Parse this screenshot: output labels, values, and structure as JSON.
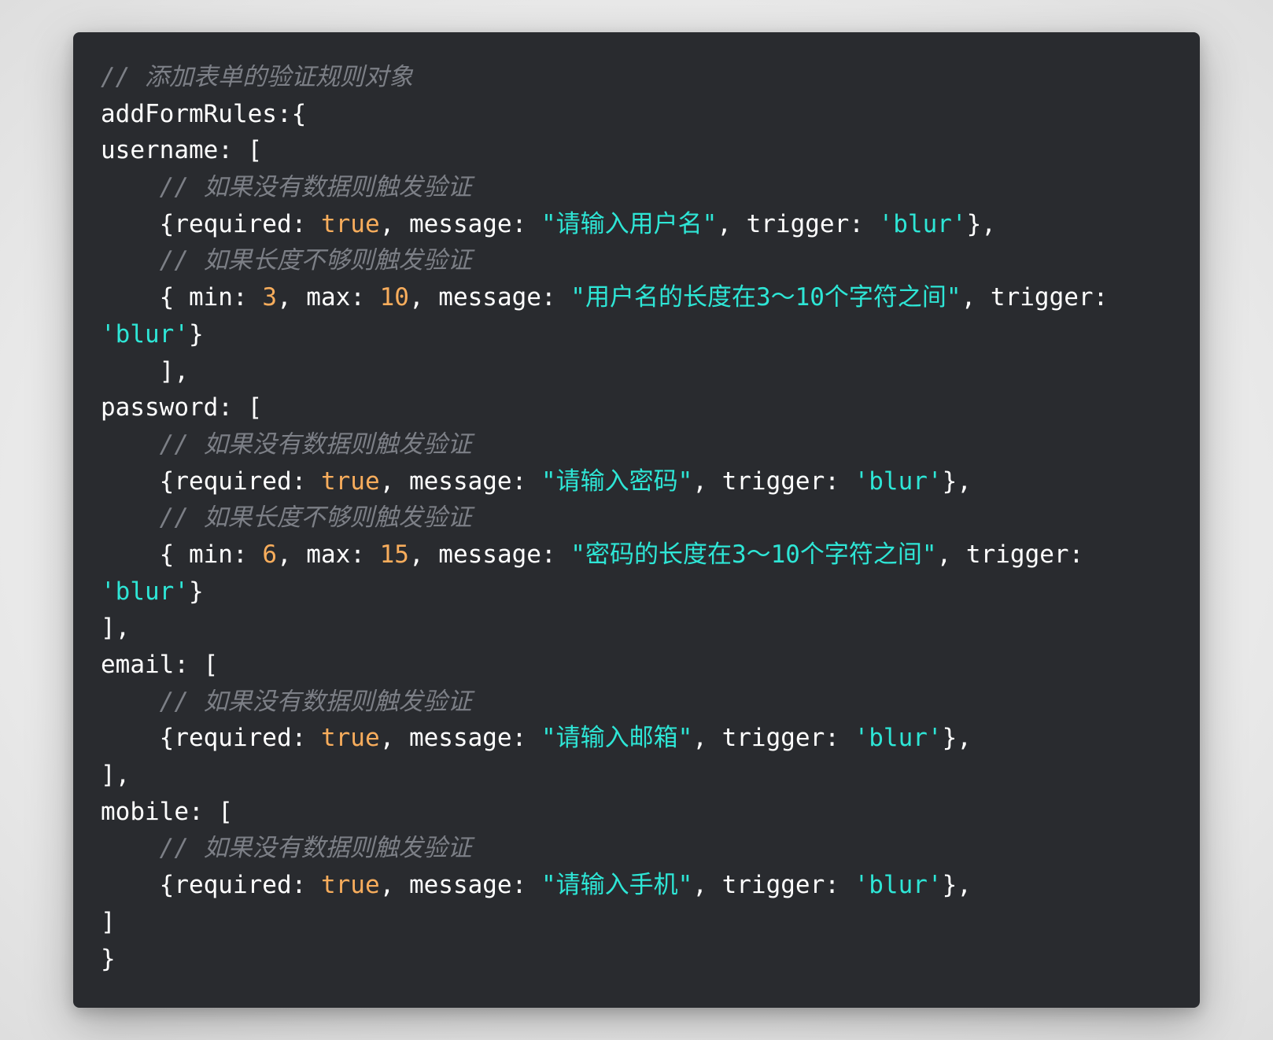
{
  "code": {
    "language": "javascript",
    "lines": [
      [
        {
          "t": "cmt",
          "s": "// 添加表单的验证规则对象"
        }
      ],
      [
        {
          "t": "pln",
          "s": "addFormRules:{"
        }
      ],
      [
        {
          "t": "pln",
          "s": "username: ["
        }
      ],
      [
        {
          "t": "cmt",
          "s": "    // 如果没有数据则触发验证"
        }
      ],
      [
        {
          "t": "pln",
          "s": "    {required: "
        },
        {
          "t": "kw",
          "s": "true"
        },
        {
          "t": "pln",
          "s": ", message: "
        },
        {
          "t": "str",
          "s": "\"请输入用户名\""
        },
        {
          "t": "pln",
          "s": ", trigger: "
        },
        {
          "t": "str",
          "s": "'blur'"
        },
        {
          "t": "pln",
          "s": "},"
        }
      ],
      [
        {
          "t": "cmt",
          "s": "    // 如果长度不够则触发验证"
        }
      ],
      [
        {
          "t": "pln",
          "s": "    { min: "
        },
        {
          "t": "num",
          "s": "3"
        },
        {
          "t": "pln",
          "s": ", max: "
        },
        {
          "t": "num",
          "s": "10"
        },
        {
          "t": "pln",
          "s": ", message: "
        },
        {
          "t": "str",
          "s": "\"用户名的长度在3～10个字符之间\""
        },
        {
          "t": "pln",
          "s": ", trigger:"
        }
      ],
      [
        {
          "t": "str",
          "s": "'blur'"
        },
        {
          "t": "pln",
          "s": "}"
        }
      ],
      [
        {
          "t": "pln",
          "s": "    ],"
        }
      ],
      [
        {
          "t": "pln",
          "s": "password: ["
        }
      ],
      [
        {
          "t": "cmt",
          "s": "    // 如果没有数据则触发验证"
        }
      ],
      [
        {
          "t": "pln",
          "s": "    {required: "
        },
        {
          "t": "kw",
          "s": "true"
        },
        {
          "t": "pln",
          "s": ", message: "
        },
        {
          "t": "str",
          "s": "\"请输入密码\""
        },
        {
          "t": "pln",
          "s": ", trigger: "
        },
        {
          "t": "str",
          "s": "'blur'"
        },
        {
          "t": "pln",
          "s": "},"
        }
      ],
      [
        {
          "t": "cmt",
          "s": "    // 如果长度不够则触发验证"
        }
      ],
      [
        {
          "t": "pln",
          "s": "    { min: "
        },
        {
          "t": "num",
          "s": "6"
        },
        {
          "t": "pln",
          "s": ", max: "
        },
        {
          "t": "num",
          "s": "15"
        },
        {
          "t": "pln",
          "s": ", message: "
        },
        {
          "t": "str",
          "s": "\"密码的长度在3～10个字符之间\""
        },
        {
          "t": "pln",
          "s": ", trigger:"
        }
      ],
      [
        {
          "t": "str",
          "s": "'blur'"
        },
        {
          "t": "pln",
          "s": "}"
        }
      ],
      [
        {
          "t": "pln",
          "s": "],"
        }
      ],
      [
        {
          "t": "pln",
          "s": "email: ["
        }
      ],
      [
        {
          "t": "cmt",
          "s": "    // 如果没有数据则触发验证"
        }
      ],
      [
        {
          "t": "pln",
          "s": "    {required: "
        },
        {
          "t": "kw",
          "s": "true"
        },
        {
          "t": "pln",
          "s": ", message: "
        },
        {
          "t": "str",
          "s": "\"请输入邮箱\""
        },
        {
          "t": "pln",
          "s": ", trigger: "
        },
        {
          "t": "str",
          "s": "'blur'"
        },
        {
          "t": "pln",
          "s": "},"
        }
      ],
      [
        {
          "t": "pln",
          "s": "],"
        }
      ],
      [
        {
          "t": "pln",
          "s": "mobile: ["
        }
      ],
      [
        {
          "t": "cmt",
          "s": "    // 如果没有数据则触发验证"
        }
      ],
      [
        {
          "t": "pln",
          "s": "    {required: "
        },
        {
          "t": "kw",
          "s": "true"
        },
        {
          "t": "pln",
          "s": ", message: "
        },
        {
          "t": "str",
          "s": "\"请输入手机\""
        },
        {
          "t": "pln",
          "s": ", trigger: "
        },
        {
          "t": "str",
          "s": "'blur'"
        },
        {
          "t": "pln",
          "s": "},"
        }
      ],
      [
        {
          "t": "pln",
          "s": "]"
        }
      ],
      [
        {
          "t": "pln",
          "s": "}"
        }
      ]
    ]
  },
  "colors": {
    "background": "#292b2f",
    "comment": "#7c7f86",
    "string": "#2ee6d6",
    "number": "#f8ad5c",
    "text": "#ffffff"
  }
}
